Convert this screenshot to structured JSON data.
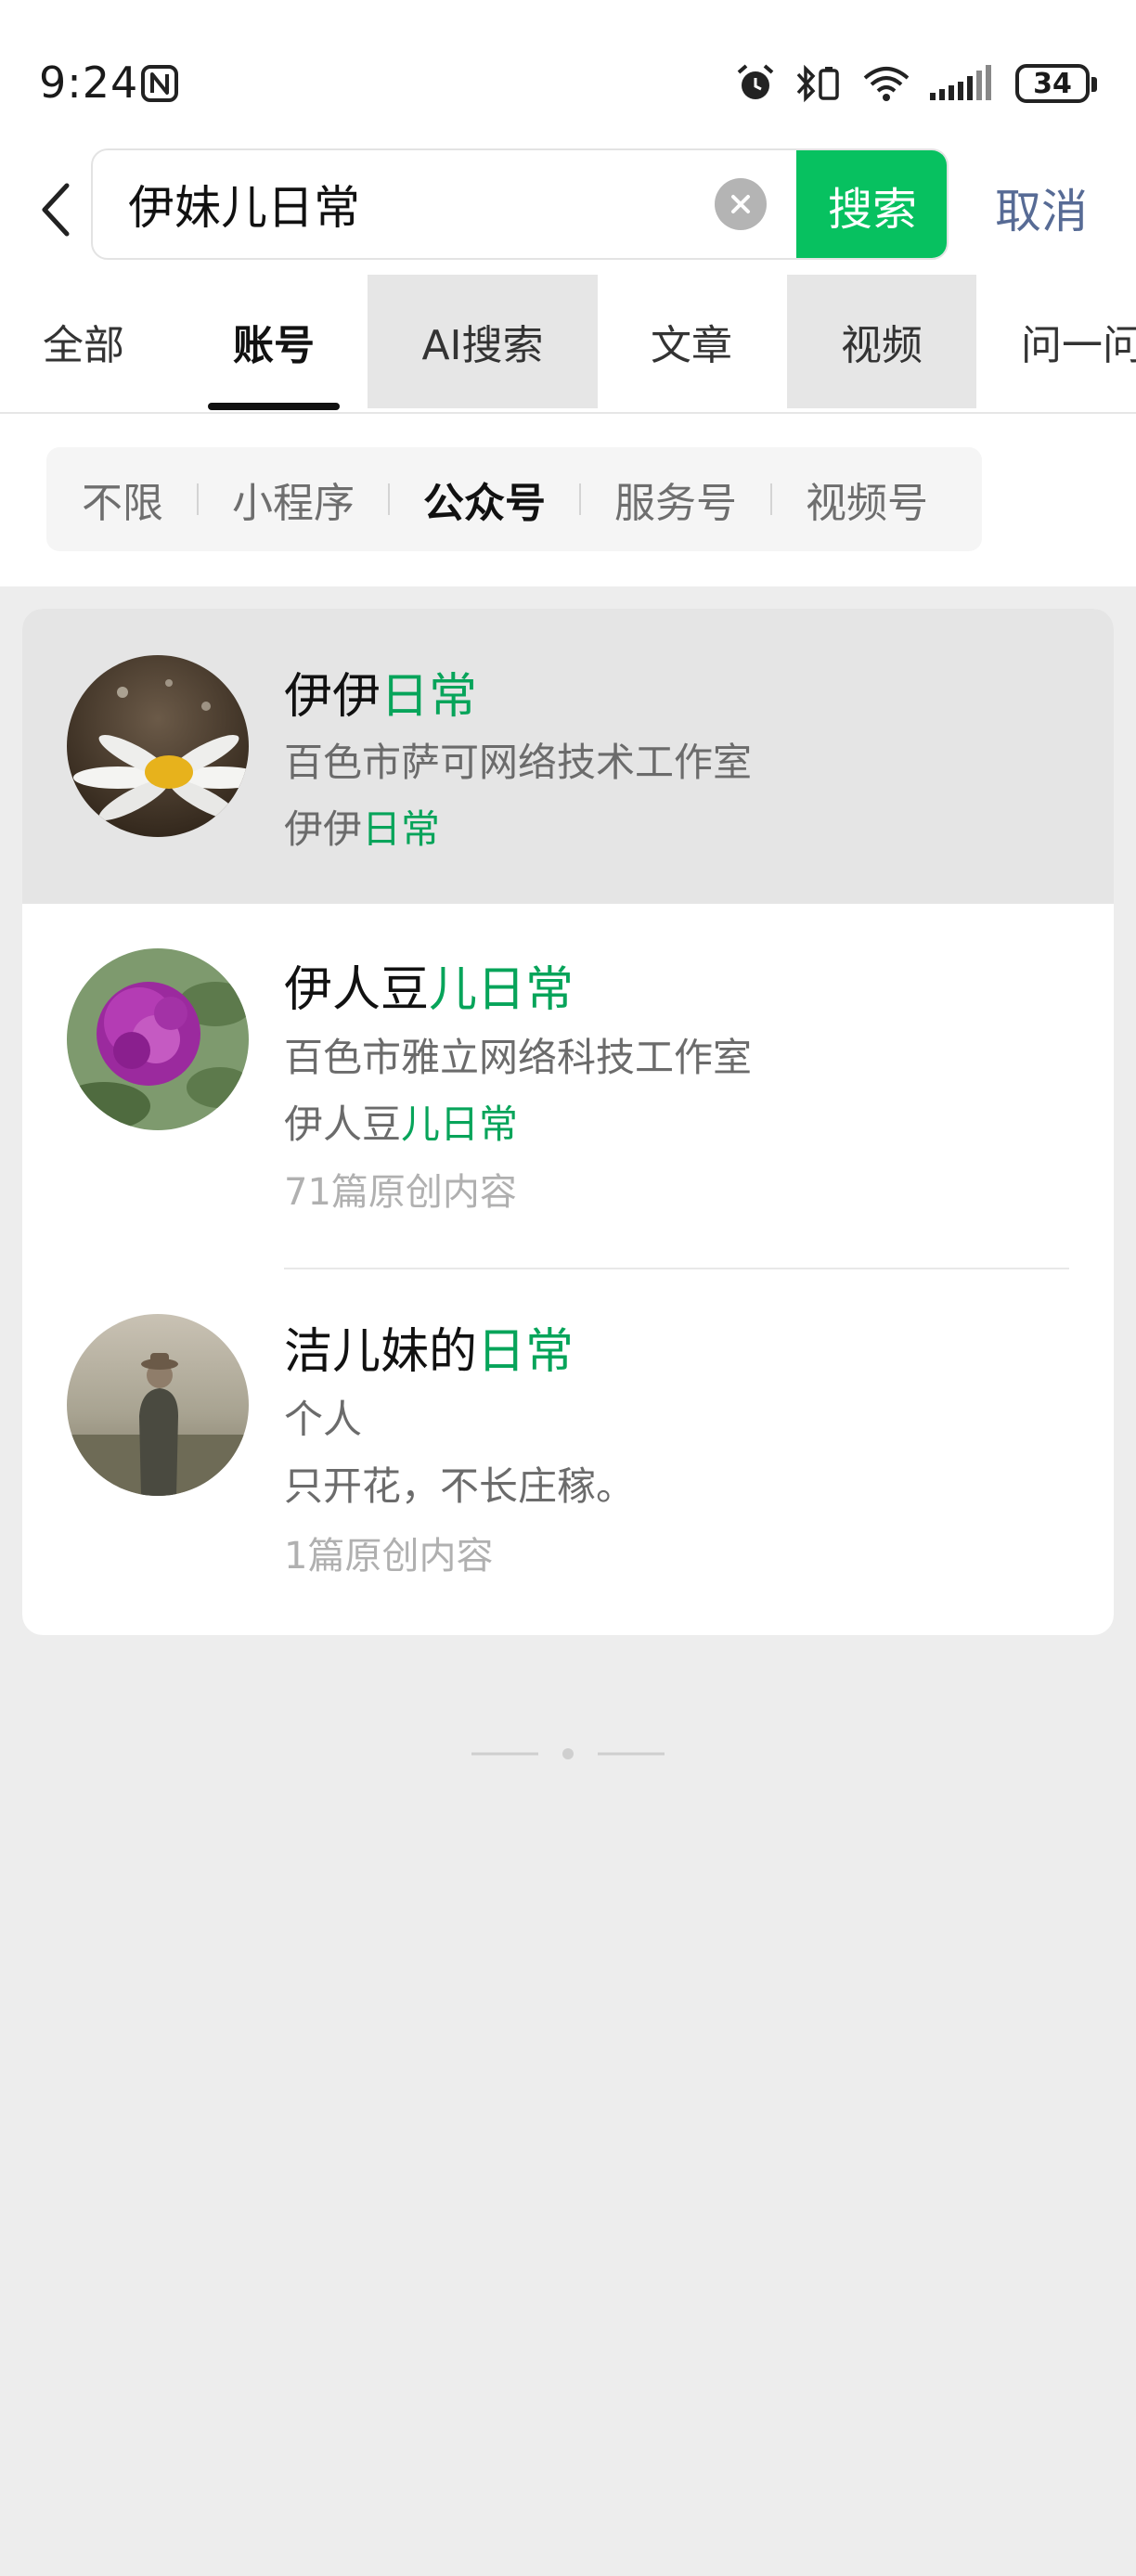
{
  "status_bar": {
    "time": "9:24",
    "battery": "34",
    "icons": [
      "nfc-icon",
      "alarm-icon",
      "bluetooth-icon",
      "wifi-icon",
      "signal-icon",
      "battery-icon"
    ]
  },
  "search": {
    "query": "伊妹儿日常",
    "button_label": "搜索",
    "cancel_label": "取消"
  },
  "tabs": [
    "全部",
    "账号",
    "AI搜索",
    "文章",
    "视频",
    "问一问"
  ],
  "active_tab": "账号",
  "filters": [
    "不限",
    "小程序",
    "公众号",
    "服务号",
    "视频号"
  ],
  "active_filter": "公众号",
  "results": [
    {
      "title_plain": "伊伊",
      "title_match": "日常",
      "subtitle": "百色市萨可网络技术工作室",
      "desc_plain": "伊伊",
      "desc_match": "日常",
      "meta": ""
    },
    {
      "title_plain": "伊人豆",
      "title_match": "儿日常",
      "subtitle": "百色市雅立网络科技工作室",
      "desc_plain": "伊人豆",
      "desc_match": "儿日常",
      "meta": "71篇原创内容"
    },
    {
      "title_plain": "洁儿妹的",
      "title_match": "日常",
      "subtitle": "个人",
      "desc_plain": "只开花，不长庄稼。",
      "desc_match": "",
      "meta": "1篇原创内容"
    }
  ],
  "colors": {
    "accent": "#07c160",
    "match_highlight": "#07a45a",
    "cancel_link": "#576b95",
    "page_bg": "#ededed"
  }
}
